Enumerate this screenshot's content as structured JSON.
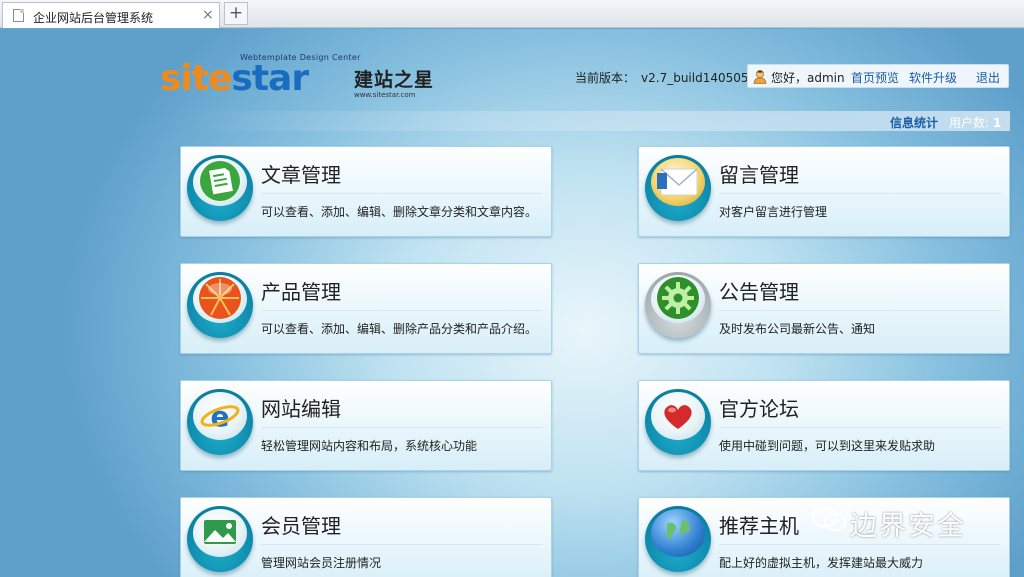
{
  "browser": {
    "tab_title": "企业网站后台管理系统",
    "close_glyph": "×",
    "new_tab_glyph": "+"
  },
  "header": {
    "logo": {
      "tagline": "Webtemplate Design Center",
      "brand_part1": "site",
      "brand_part2": "star",
      "brand_cn": "建站之星",
      "url": "www.sitestar.com"
    },
    "version_label": "当前版本：",
    "version_value": "v2.7_build140505",
    "greeting": "您好，admin",
    "links": {
      "preview": "首页预览",
      "upgrade": "软件升级",
      "logout": "退出"
    }
  },
  "stats": {
    "link": "信息统计",
    "users_label": "用户数:",
    "users_value": "1"
  },
  "cards": [
    {
      "title": "文章管理",
      "desc": "可以查看、添加、编辑、删除文章分类和文章内容。",
      "icon": "article-icon"
    },
    {
      "title": "留言管理",
      "desc": "对客户留言进行管理",
      "icon": "message-icon"
    },
    {
      "title": "产品管理",
      "desc": "可以查看、添加、编辑、删除产品分类和产品介绍。",
      "icon": "product-icon"
    },
    {
      "title": "公告管理",
      "desc": "及时发布公司最新公告、通知",
      "icon": "announcement-gear-icon"
    },
    {
      "title": "网站编辑",
      "desc": "轻松管理网站内容和布局，系统核心功能",
      "icon": "ie-browser-icon"
    },
    {
      "title": "官方论坛",
      "desc": "使用中碰到问题，可以到这里来发贴求助",
      "icon": "heart-icon"
    },
    {
      "title": "会员管理",
      "desc": "管理网站会员注册情况",
      "icon": "member-picture-icon"
    },
    {
      "title": "推荐主机",
      "desc": "配上好的虚拟主机，发挥建站最大威力",
      "icon": "globe-icon"
    }
  ],
  "watermark": "边界安全",
  "colors": {
    "link": "#1a5aa5",
    "brand_orange": "#f08a1c",
    "brand_blue": "#1a6cc0",
    "icon_teal": "#0e8aac"
  }
}
